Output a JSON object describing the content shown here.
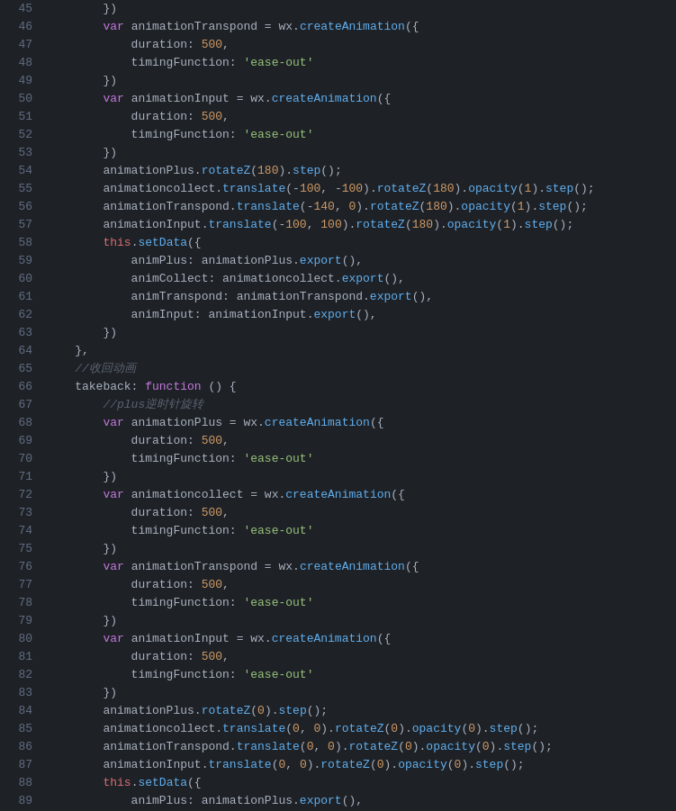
{
  "lines": [
    {
      "num": 45,
      "tokens": [
        {
          "t": "plain",
          "v": "        })"
        }
      ]
    },
    {
      "num": 46,
      "tokens": [
        {
          "t": "plain",
          "v": "        "
        },
        {
          "t": "kw",
          "v": "var"
        },
        {
          "t": "plain",
          "v": " animationTranspond = wx."
        },
        {
          "t": "fn",
          "v": "createAnimation"
        },
        {
          "t": "plain",
          "v": "({"
        }
      ]
    },
    {
      "num": 47,
      "tokens": [
        {
          "t": "plain",
          "v": "            duration: "
        },
        {
          "t": "num",
          "v": "500"
        },
        {
          "t": "plain",
          "v": ","
        }
      ]
    },
    {
      "num": 48,
      "tokens": [
        {
          "t": "plain",
          "v": "            timingFunction: "
        },
        {
          "t": "str",
          "v": "'ease-out'"
        }
      ]
    },
    {
      "num": 49,
      "tokens": [
        {
          "t": "plain",
          "v": "        })"
        }
      ]
    },
    {
      "num": 50,
      "tokens": [
        {
          "t": "plain",
          "v": "        "
        },
        {
          "t": "kw",
          "v": "var"
        },
        {
          "t": "plain",
          "v": " animationInput = wx."
        },
        {
          "t": "fn",
          "v": "createAnimation"
        },
        {
          "t": "plain",
          "v": "({"
        }
      ]
    },
    {
      "num": 51,
      "tokens": [
        {
          "t": "plain",
          "v": "            duration: "
        },
        {
          "t": "num",
          "v": "500"
        },
        {
          "t": "plain",
          "v": ","
        }
      ]
    },
    {
      "num": 52,
      "tokens": [
        {
          "t": "plain",
          "v": "            timingFunction: "
        },
        {
          "t": "str",
          "v": "'ease-out'"
        }
      ]
    },
    {
      "num": 53,
      "tokens": [
        {
          "t": "plain",
          "v": "        })"
        }
      ]
    },
    {
      "num": 54,
      "tokens": [
        {
          "t": "plain",
          "v": "        animationPlus."
        },
        {
          "t": "fn",
          "v": "rotateZ"
        },
        {
          "t": "plain",
          "v": "("
        },
        {
          "t": "num",
          "v": "180"
        },
        {
          "t": "plain",
          "v": ")."
        },
        {
          "t": "fn",
          "v": "step"
        },
        {
          "t": "plain",
          "v": "();"
        }
      ]
    },
    {
      "num": 55,
      "tokens": [
        {
          "t": "plain",
          "v": "        animationcollect."
        },
        {
          "t": "fn",
          "v": "translate"
        },
        {
          "t": "plain",
          "v": "(-"
        },
        {
          "t": "num",
          "v": "100"
        },
        {
          "t": "plain",
          "v": ", -"
        },
        {
          "t": "num",
          "v": "100"
        },
        {
          "t": "plain",
          "v": ")."
        },
        {
          "t": "fn",
          "v": "rotateZ"
        },
        {
          "t": "plain",
          "v": "("
        },
        {
          "t": "num",
          "v": "180"
        },
        {
          "t": "plain",
          "v": ")."
        },
        {
          "t": "fn",
          "v": "opacity"
        },
        {
          "t": "plain",
          "v": "("
        },
        {
          "t": "num",
          "v": "1"
        },
        {
          "t": "plain",
          "v": ")."
        },
        {
          "t": "fn",
          "v": "step"
        },
        {
          "t": "plain",
          "v": "();"
        }
      ]
    },
    {
      "num": 56,
      "tokens": [
        {
          "t": "plain",
          "v": "        animationTranspond."
        },
        {
          "t": "fn",
          "v": "translate"
        },
        {
          "t": "plain",
          "v": "(-"
        },
        {
          "t": "num",
          "v": "140"
        },
        {
          "t": "plain",
          "v": ", "
        },
        {
          "t": "num",
          "v": "0"
        },
        {
          "t": "plain",
          "v": ")."
        },
        {
          "t": "fn",
          "v": "rotateZ"
        },
        {
          "t": "plain",
          "v": "("
        },
        {
          "t": "num",
          "v": "180"
        },
        {
          "t": "plain",
          "v": ")."
        },
        {
          "t": "fn",
          "v": "opacity"
        },
        {
          "t": "plain",
          "v": "("
        },
        {
          "t": "num",
          "v": "1"
        },
        {
          "t": "plain",
          "v": ")."
        },
        {
          "t": "fn",
          "v": "step"
        },
        {
          "t": "plain",
          "v": "();"
        }
      ]
    },
    {
      "num": 57,
      "tokens": [
        {
          "t": "plain",
          "v": "        animationInput."
        },
        {
          "t": "fn",
          "v": "translate"
        },
        {
          "t": "plain",
          "v": "(-"
        },
        {
          "t": "num",
          "v": "100"
        },
        {
          "t": "plain",
          "v": ", "
        },
        {
          "t": "num",
          "v": "100"
        },
        {
          "t": "plain",
          "v": ")."
        },
        {
          "t": "fn",
          "v": "rotateZ"
        },
        {
          "t": "plain",
          "v": "("
        },
        {
          "t": "num",
          "v": "180"
        },
        {
          "t": "plain",
          "v": ")."
        },
        {
          "t": "fn",
          "v": "opacity"
        },
        {
          "t": "plain",
          "v": "("
        },
        {
          "t": "num",
          "v": "1"
        },
        {
          "t": "plain",
          "v": ")."
        },
        {
          "t": "fn",
          "v": "step"
        },
        {
          "t": "plain",
          "v": "();"
        }
      ]
    },
    {
      "num": 58,
      "tokens": [
        {
          "t": "plain",
          "v": "        "
        },
        {
          "t": "this-kw",
          "v": "this"
        },
        {
          "t": "plain",
          "v": "."
        },
        {
          "t": "fn",
          "v": "setData"
        },
        {
          "t": "plain",
          "v": "({"
        }
      ]
    },
    {
      "num": 59,
      "tokens": [
        {
          "t": "plain",
          "v": "            animPlus: animationPlus."
        },
        {
          "t": "fn",
          "v": "export"
        },
        {
          "t": "plain",
          "v": "(),"
        }
      ]
    },
    {
      "num": 60,
      "tokens": [
        {
          "t": "plain",
          "v": "            animCollect: animationcollect."
        },
        {
          "t": "fn",
          "v": "export"
        },
        {
          "t": "plain",
          "v": "(),"
        }
      ]
    },
    {
      "num": 61,
      "tokens": [
        {
          "t": "plain",
          "v": "            animTranspond: animationTranspond."
        },
        {
          "t": "fn",
          "v": "export"
        },
        {
          "t": "plain",
          "v": "(),"
        }
      ]
    },
    {
      "num": 62,
      "tokens": [
        {
          "t": "plain",
          "v": "            animInput: animationInput."
        },
        {
          "t": "fn",
          "v": "export"
        },
        {
          "t": "plain",
          "v": "(),"
        }
      ]
    },
    {
      "num": 63,
      "tokens": [
        {
          "t": "plain",
          "v": "        })"
        }
      ]
    },
    {
      "num": 64,
      "tokens": [
        {
          "t": "plain",
          "v": "    },"
        }
      ]
    },
    {
      "num": 65,
      "tokens": [
        {
          "t": "comment",
          "v": "    //收回动画"
        }
      ]
    },
    {
      "num": 66,
      "tokens": [
        {
          "t": "plain",
          "v": "    takeback: "
        },
        {
          "t": "kw",
          "v": "function"
        },
        {
          "t": "plain",
          "v": " () {"
        }
      ]
    },
    {
      "num": 67,
      "tokens": [
        {
          "t": "comment",
          "v": "        //plus逆时针旋转"
        }
      ]
    },
    {
      "num": 68,
      "tokens": [
        {
          "t": "plain",
          "v": "        "
        },
        {
          "t": "kw",
          "v": "var"
        },
        {
          "t": "plain",
          "v": " animationPlus = wx."
        },
        {
          "t": "fn",
          "v": "createAnimation"
        },
        {
          "t": "plain",
          "v": "({"
        }
      ]
    },
    {
      "num": 69,
      "tokens": [
        {
          "t": "plain",
          "v": "            duration: "
        },
        {
          "t": "num",
          "v": "500"
        },
        {
          "t": "plain",
          "v": ","
        }
      ]
    },
    {
      "num": 70,
      "tokens": [
        {
          "t": "plain",
          "v": "            timingFunction: "
        },
        {
          "t": "str",
          "v": "'ease-out'"
        }
      ]
    },
    {
      "num": 71,
      "tokens": [
        {
          "t": "plain",
          "v": "        })"
        }
      ]
    },
    {
      "num": 72,
      "tokens": [
        {
          "t": "plain",
          "v": "        "
        },
        {
          "t": "kw",
          "v": "var"
        },
        {
          "t": "plain",
          "v": " animationcollect = wx."
        },
        {
          "t": "fn",
          "v": "createAnimation"
        },
        {
          "t": "plain",
          "v": "({"
        }
      ]
    },
    {
      "num": 73,
      "tokens": [
        {
          "t": "plain",
          "v": "            duration: "
        },
        {
          "t": "num",
          "v": "500"
        },
        {
          "t": "plain",
          "v": ","
        }
      ]
    },
    {
      "num": 74,
      "tokens": [
        {
          "t": "plain",
          "v": "            timingFunction: "
        },
        {
          "t": "str",
          "v": "'ease-out'"
        }
      ]
    },
    {
      "num": 75,
      "tokens": [
        {
          "t": "plain",
          "v": "        })"
        }
      ]
    },
    {
      "num": 76,
      "tokens": [
        {
          "t": "plain",
          "v": "        "
        },
        {
          "t": "kw",
          "v": "var"
        },
        {
          "t": "plain",
          "v": " animationTranspond = wx."
        },
        {
          "t": "fn",
          "v": "createAnimation"
        },
        {
          "t": "plain",
          "v": "({"
        }
      ]
    },
    {
      "num": 77,
      "tokens": [
        {
          "t": "plain",
          "v": "            duration: "
        },
        {
          "t": "num",
          "v": "500"
        },
        {
          "t": "plain",
          "v": ","
        }
      ]
    },
    {
      "num": 78,
      "tokens": [
        {
          "t": "plain",
          "v": "            timingFunction: "
        },
        {
          "t": "str",
          "v": "'ease-out'"
        }
      ]
    },
    {
      "num": 79,
      "tokens": [
        {
          "t": "plain",
          "v": "        })"
        }
      ]
    },
    {
      "num": 80,
      "tokens": [
        {
          "t": "plain",
          "v": "        "
        },
        {
          "t": "kw",
          "v": "var"
        },
        {
          "t": "plain",
          "v": " animationInput = wx."
        },
        {
          "t": "fn",
          "v": "createAnimation"
        },
        {
          "t": "plain",
          "v": "({"
        }
      ]
    },
    {
      "num": 81,
      "tokens": [
        {
          "t": "plain",
          "v": "            duration: "
        },
        {
          "t": "num",
          "v": "500"
        },
        {
          "t": "plain",
          "v": ","
        }
      ]
    },
    {
      "num": 82,
      "tokens": [
        {
          "t": "plain",
          "v": "            timingFunction: "
        },
        {
          "t": "str",
          "v": "'ease-out'"
        }
      ]
    },
    {
      "num": 83,
      "tokens": [
        {
          "t": "plain",
          "v": "        })"
        }
      ]
    },
    {
      "num": 84,
      "tokens": [
        {
          "t": "plain",
          "v": "        animationPlus."
        },
        {
          "t": "fn",
          "v": "rotateZ"
        },
        {
          "t": "plain",
          "v": "("
        },
        {
          "t": "num",
          "v": "0"
        },
        {
          "t": "plain",
          "v": ")."
        },
        {
          "t": "fn",
          "v": "step"
        },
        {
          "t": "plain",
          "v": "();"
        }
      ]
    },
    {
      "num": 85,
      "tokens": [
        {
          "t": "plain",
          "v": "        animationcollect."
        },
        {
          "t": "fn",
          "v": "translate"
        },
        {
          "t": "plain",
          "v": "("
        },
        {
          "t": "num",
          "v": "0"
        },
        {
          "t": "plain",
          "v": ", "
        },
        {
          "t": "num",
          "v": "0"
        },
        {
          "t": "plain",
          "v": ")."
        },
        {
          "t": "fn",
          "v": "rotateZ"
        },
        {
          "t": "plain",
          "v": "("
        },
        {
          "t": "num",
          "v": "0"
        },
        {
          "t": "plain",
          "v": ")."
        },
        {
          "t": "fn",
          "v": "opacity"
        },
        {
          "t": "plain",
          "v": "("
        },
        {
          "t": "num",
          "v": "0"
        },
        {
          "t": "plain",
          "v": ")."
        },
        {
          "t": "fn",
          "v": "step"
        },
        {
          "t": "plain",
          "v": "();"
        }
      ]
    },
    {
      "num": 86,
      "tokens": [
        {
          "t": "plain",
          "v": "        animationTranspond."
        },
        {
          "t": "fn",
          "v": "translate"
        },
        {
          "t": "plain",
          "v": "("
        },
        {
          "t": "num",
          "v": "0"
        },
        {
          "t": "plain",
          "v": ", "
        },
        {
          "t": "num",
          "v": "0"
        },
        {
          "t": "plain",
          "v": ")."
        },
        {
          "t": "fn",
          "v": "rotateZ"
        },
        {
          "t": "plain",
          "v": "("
        },
        {
          "t": "num",
          "v": "0"
        },
        {
          "t": "plain",
          "v": ")."
        },
        {
          "t": "fn",
          "v": "opacity"
        },
        {
          "t": "plain",
          "v": "("
        },
        {
          "t": "num",
          "v": "0"
        },
        {
          "t": "plain",
          "v": ")."
        },
        {
          "t": "fn",
          "v": "step"
        },
        {
          "t": "plain",
          "v": "();"
        }
      ]
    },
    {
      "num": 87,
      "tokens": [
        {
          "t": "plain",
          "v": "        animationInput."
        },
        {
          "t": "fn",
          "v": "translate"
        },
        {
          "t": "plain",
          "v": "("
        },
        {
          "t": "num",
          "v": "0"
        },
        {
          "t": "plain",
          "v": ", "
        },
        {
          "t": "num",
          "v": "0"
        },
        {
          "t": "plain",
          "v": ")."
        },
        {
          "t": "fn",
          "v": "rotateZ"
        },
        {
          "t": "plain",
          "v": "("
        },
        {
          "t": "num",
          "v": "0"
        },
        {
          "t": "plain",
          "v": ")."
        },
        {
          "t": "fn",
          "v": "opacity"
        },
        {
          "t": "plain",
          "v": "("
        },
        {
          "t": "num",
          "v": "0"
        },
        {
          "t": "plain",
          "v": ")."
        },
        {
          "t": "fn",
          "v": "step"
        },
        {
          "t": "plain",
          "v": "();"
        }
      ]
    },
    {
      "num": 88,
      "tokens": [
        {
          "t": "plain",
          "v": "        "
        },
        {
          "t": "this-kw",
          "v": "this"
        },
        {
          "t": "plain",
          "v": "."
        },
        {
          "t": "fn",
          "v": "setData"
        },
        {
          "t": "plain",
          "v": "({"
        }
      ]
    },
    {
      "num": 89,
      "tokens": [
        {
          "t": "plain",
          "v": "            animPlus: animationPlus."
        },
        {
          "t": "fn",
          "v": "export"
        },
        {
          "t": "plain",
          "v": "(),"
        }
      ]
    }
  ]
}
